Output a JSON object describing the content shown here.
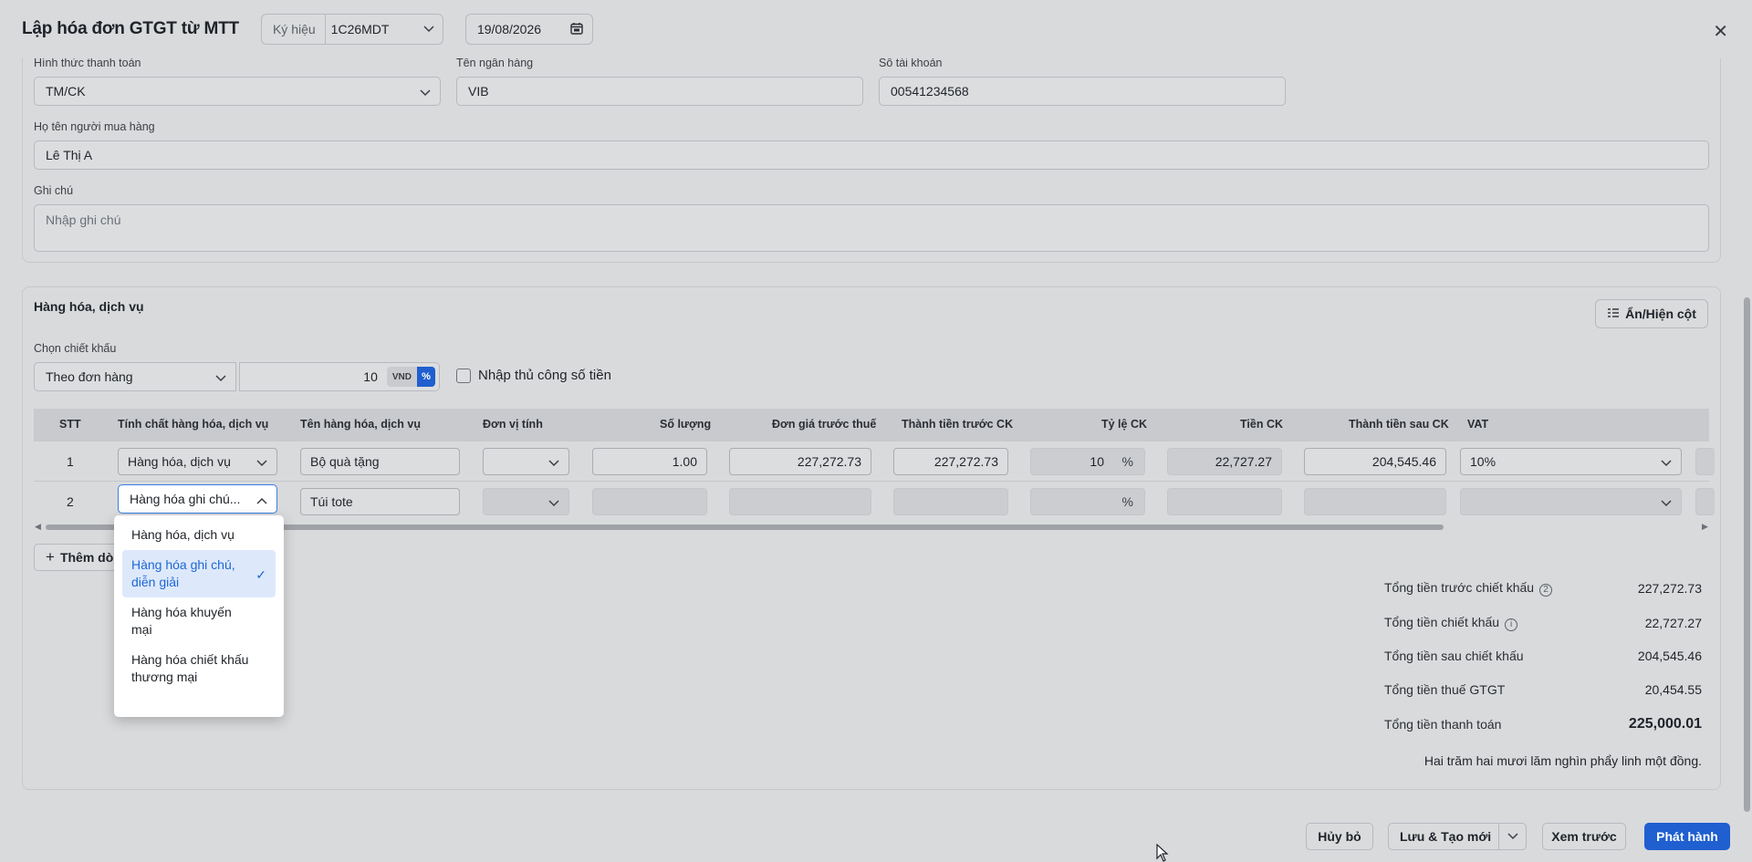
{
  "header": {
    "title": "Lập hóa đơn GTGT từ MTT",
    "kyhieu_label": "Ký hiệu",
    "kyhieu_value": "1C26MDT",
    "date": "19/08/2026"
  },
  "form": {
    "payment_label": "Hình thức thanh toán",
    "payment_value": "TM/CK",
    "bank_label": "Tên ngân hàng",
    "bank_value": "VIB",
    "account_label": "Số tài khoản",
    "account_value": "00541234568",
    "buyer_label": "Họ tên người mua hàng",
    "buyer_value": "Lê Thị A",
    "note_label": "Ghi chú",
    "note_placeholder": "Nhập ghi chú"
  },
  "goods": {
    "section_title": "Hàng hóa, dịch vụ",
    "toggle_columns_label": "Ẩn/Hiện cột",
    "discount_label": "Chọn chiết khấu",
    "discount_type": "Theo đơn hàng",
    "discount_value": "10",
    "unit_vnd": "VND",
    "unit_pct": "%",
    "manual_label": "Nhập thủ công số tiền",
    "add_row_label": "Thêm dòng",
    "columns": [
      "STT",
      "Tính chất hàng hóa, dịch vụ",
      "Tên hàng hóa, dịch vụ",
      "Đơn vị tính",
      "Số lượng",
      "Đơn giá trước thuế",
      "Thành tiền trước CK",
      "Tỷ lệ CK",
      "Tiền CK",
      "Thành tiền sau CK",
      "VAT"
    ],
    "rows": [
      {
        "stt": "1",
        "nature": "Hàng hóa, dịch vụ",
        "name": "Bộ quà tặng",
        "unit": "",
        "qty": "1.00",
        "price": "227,272.73",
        "amount": "227,272.73",
        "rate": "10",
        "rate_unit": "%",
        "disc": "22,727.27",
        "after": "204,545.46",
        "vat": "10%"
      },
      {
        "stt": "2",
        "nature": "Hàng hóa ghi chú...",
        "name": "Túi tote",
        "unit": "",
        "qty": "",
        "price": "",
        "amount": "",
        "rate": "",
        "rate_unit": "%",
        "disc": "",
        "after": "",
        "vat": ""
      }
    ]
  },
  "dropdown": {
    "options": [
      "Hàng hóa, dịch vụ",
      "Hàng hóa ghi chú, diễn giải",
      "Hàng hóa khuyến mại",
      "Hàng hóa chiết khấu thương mại"
    ],
    "selected_index": 1
  },
  "totals": {
    "pre_discount_label": "Tổng tiền trước chiết khấu",
    "pre_discount_value": "227,272.73",
    "discount_label": "Tổng tiền chiết khấu",
    "discount_value": "22,727.27",
    "post_discount_label": "Tổng tiền sau chiết khấu",
    "post_discount_value": "204,545.46",
    "vat_label": "Tổng tiền thuế GTGT",
    "vat_value": "20,454.55",
    "total_label": "Tổng tiền thanh toán",
    "total_value": "225,000.01",
    "in_words": "Hai trăm hai mươi lăm nghìn phẩy linh một đồng."
  },
  "footer": {
    "cancel_label": "Hủy bỏ",
    "save_new_label": "Lưu & Tạo mới",
    "preview_label": "Xem trước",
    "issue_label": "Phát hành"
  },
  "colors": {
    "primary": "#1f5fcf",
    "focus": "#3a7ee6"
  }
}
